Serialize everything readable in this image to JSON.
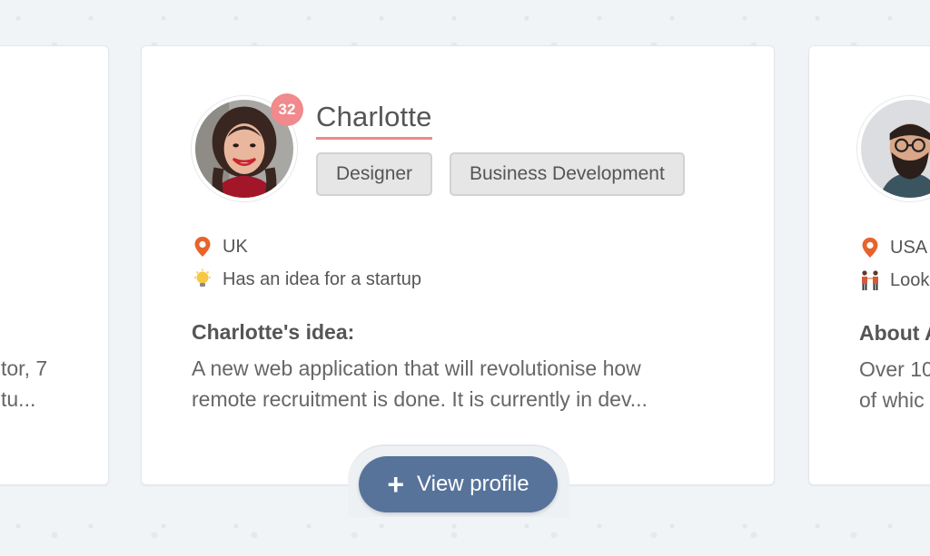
{
  "left_card": {
    "text_line1": "tor, 7",
    "text_line2": "tu..."
  },
  "main_card": {
    "badge": "32",
    "name": "Charlotte",
    "tags": [
      "Designer",
      "Business Development"
    ],
    "location": "UK",
    "status": "Has an idea for a startup",
    "section_title": "Charlotte's idea:",
    "section_line1": "A new web application that will revolutionise how",
    "section_line2": "remote recruitment is done. It is currently in dev...",
    "button_label": "View profile"
  },
  "right_card": {
    "location": "USA",
    "status": "Look",
    "section_title": "About A",
    "section_line1": "Over 10",
    "section_line2": "of whic"
  },
  "colors": {
    "accent": "#f0888a",
    "button": "#57739a",
    "pin": "#e8632b"
  },
  "icons": [
    "location-pin-icon",
    "lightbulb-icon",
    "handshake-icon",
    "plus-icon"
  ]
}
